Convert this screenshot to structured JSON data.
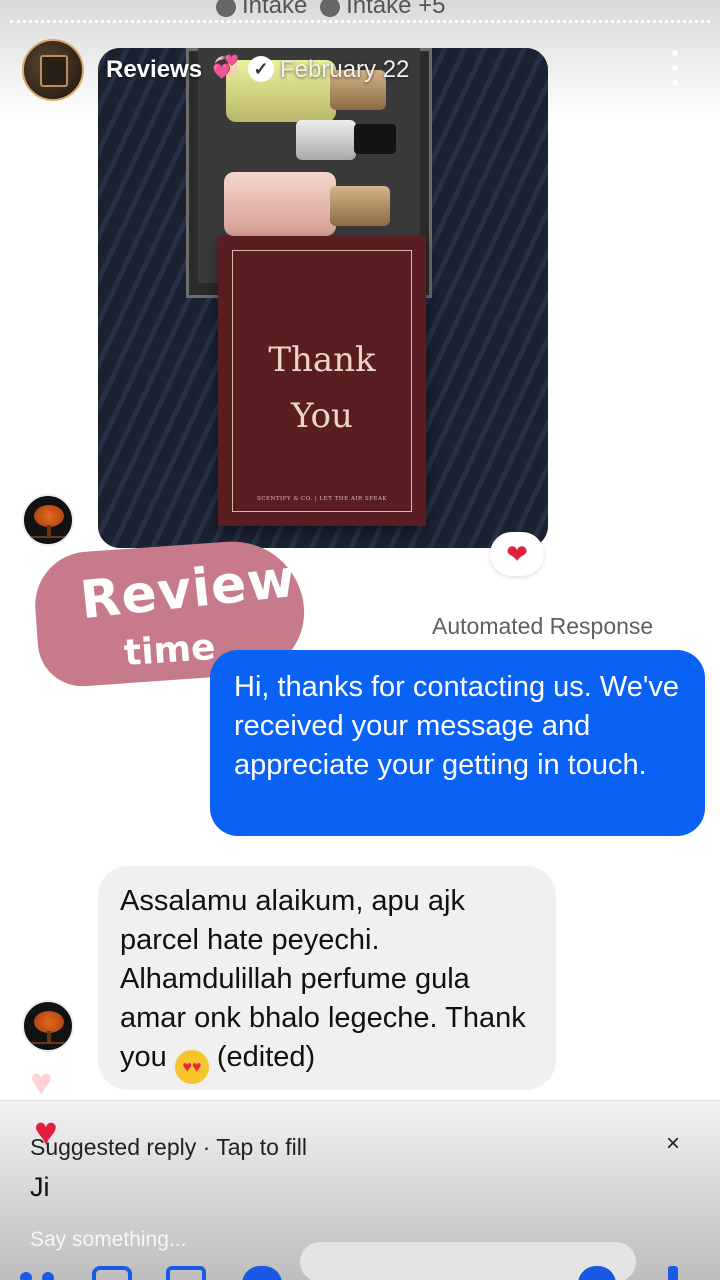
{
  "top_strip": {
    "left_text": "Intake",
    "right_text": "Intake +5"
  },
  "story": {
    "title": "Reviews",
    "title_emoji": "💞",
    "date": "February 22"
  },
  "photo": {
    "card_line1": "Thank",
    "card_line2": "You",
    "card_footer": "SCENTIFY & CO. | LET THE AIR SPEAK"
  },
  "sticker": {
    "word1": "Review",
    "word2": "time"
  },
  "automated_label": "Automated Response",
  "auto_message": "Hi, thanks for contacting us. We've received your message and appreciate your getting in touch.",
  "customer_message": {
    "text": "Assalamu alaikum, apu ajk parcel hate peyechi. Alhamdulillah perfume gula amar onk bhalo legeche. Thank you",
    "emoji": "😍",
    "edited": "(edited)"
  },
  "suggested": {
    "label": "Suggested reply · Tap to fill",
    "reply": "Ji",
    "close": "×"
  },
  "composer": {
    "placeholder": "Say something..."
  },
  "colors": {
    "message_blue": "#0a62f5",
    "bubble_grey": "#f0f0f0",
    "reaction_heart": "#e41e3f",
    "sticker_pink": "#c77a8a"
  },
  "icons": [
    "more-vertical-icon",
    "verified-badge-icon",
    "heart-icon",
    "close-icon"
  ]
}
